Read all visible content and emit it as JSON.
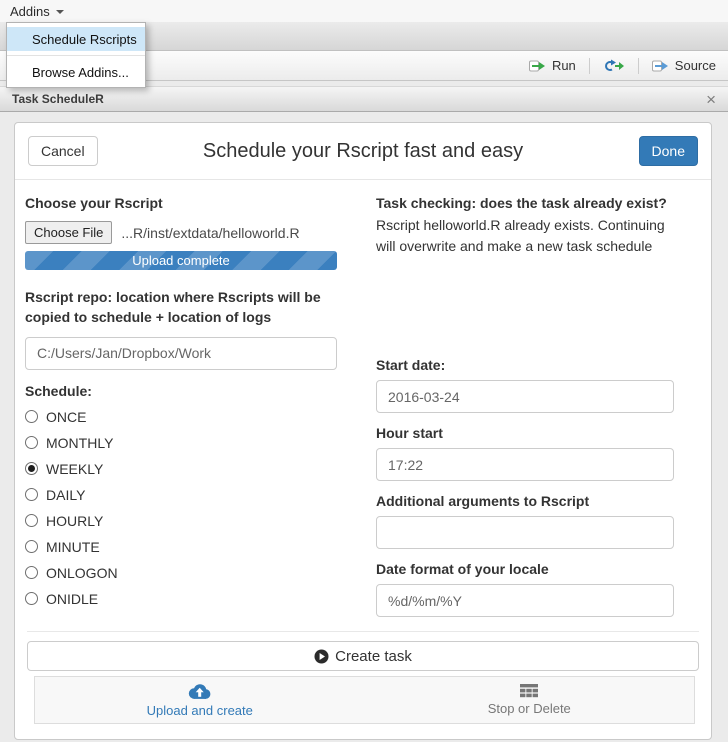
{
  "menubar": {
    "addins_label": "Addins"
  },
  "addins_dropdown": {
    "items": [
      {
        "label": "Schedule Rscripts",
        "highlighted": true
      },
      {
        "label": "Browse Addins...",
        "highlighted": false
      }
    ]
  },
  "editor_toolbar": {
    "run_label": "Run",
    "source_label": "Source"
  },
  "panel": {
    "title": "Task ScheduleR",
    "close_glyph": "×"
  },
  "dialog": {
    "cancel_label": "Cancel",
    "title": "Schedule your Rscript fast and easy",
    "done_label": "Done",
    "left": {
      "choose_label": "Choose your Rscript",
      "choose_file_button": "Choose File",
      "file_name": "...R/inst/extdata/helloworld.R",
      "upload_status": "Upload complete",
      "repo_label": "Rscript repo: location where Rscripts will be copied to schedule + location of logs",
      "repo_value": "C:/Users/Jan/Dropbox/Work",
      "schedule_label": "Schedule:"
    },
    "schedule": {
      "options": [
        {
          "label": "ONCE",
          "selected": false
        },
        {
          "label": "MONTHLY",
          "selected": false
        },
        {
          "label": "WEEKLY",
          "selected": true
        },
        {
          "label": "DAILY",
          "selected": false
        },
        {
          "label": "HOURLY",
          "selected": false
        },
        {
          "label": "MINUTE",
          "selected": false
        },
        {
          "label": "ONLOGON",
          "selected": false
        },
        {
          "label": "ONIDLE",
          "selected": false
        }
      ]
    },
    "right": {
      "task_check_title": "Task checking: does the task already exist?",
      "task_check_text": "Rscript helloworld.R already exists. Continuing will overwrite and make a new task schedule",
      "start_date_label": "Start date:",
      "start_date_value": "2016-03-24",
      "hour_label": "Hour start",
      "hour_value": "17:22",
      "args_label": "Additional arguments to Rscript",
      "args_value": "",
      "dateformat_label": "Date format of your locale",
      "dateformat_value": "%d/%m/%Y"
    },
    "create_button": "Create task",
    "footer": {
      "tabs": [
        {
          "label": "Upload and create",
          "icon": "cloud-upload-icon",
          "active": true
        },
        {
          "label": "Stop or Delete",
          "icon": "table-icon",
          "active": false
        }
      ]
    }
  },
  "colors": {
    "primary": "#337ab7",
    "menu_highlight": "#cee7f8",
    "run_green": "#39a849",
    "source_blue": "#5b9bd5"
  }
}
